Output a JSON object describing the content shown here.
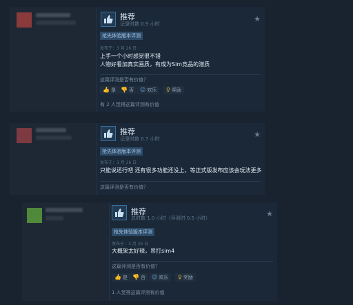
{
  "colors": {
    "bg": "#192330",
    "card": "#1b2838",
    "accent": "#66c0f4",
    "award": "#e0b43a"
  },
  "reviews": [
    {
      "title": "推荐",
      "hours": "记录时数 0.9 小时",
      "badge": "抢先体验版本评测",
      "posted": "发布于：3 月 26 日",
      "lines": [
        "上手一个小时感觉很不错",
        "人物好看加真实画质，有成为Sim竞品的潜质"
      ],
      "question": "这篇评测是否有价值？",
      "buttons": {
        "yes": "是",
        "no": "否",
        "funny": "欢乐",
        "award": "奖励"
      },
      "helpful": "有 2 人觉得这篇评测有价值"
    },
    {
      "title": "推荐",
      "hours": "记录时数 0.7 小时",
      "badge": "抢先体验版本评测",
      "posted": "发布于：3 月 26 日",
      "lines": [
        "只能说还行吧 还有很多功能还没上，等正式版发布应该会玩法更多"
      ],
      "question": "这篇评测是否有价值？"
    },
    {
      "title": "推荐",
      "hours": "总时数 1.0 小时（评测时 0.5 小时）",
      "badge": "抢先体验版本评测",
      "posted": "发布于：3 月 26 日",
      "lines": [
        "大概架太好辣，吊打sim4"
      ],
      "question": "这篇评测是否有价值？",
      "buttons": {
        "yes": "是",
        "no": "否",
        "funny": "欢乐",
        "award": "奖励"
      },
      "helpful": "1 人觉得这篇评测有价值"
    }
  ]
}
